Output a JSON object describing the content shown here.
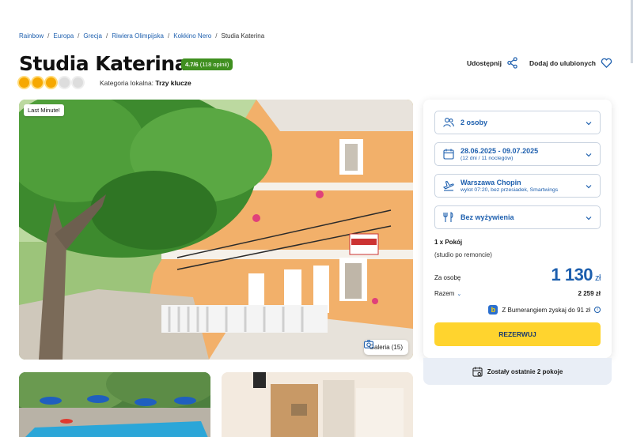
{
  "breadcrumb": [
    "Rainbow",
    "Europa",
    "Grecja",
    "Riwiera Olimpijska",
    "Kokkino Nero",
    "Studia Katerina"
  ],
  "hotel": {
    "name": "Studia Katerina",
    "rating_score": "4.7/6",
    "rating_count": "(118 opinii)",
    "stars_total": 5,
    "stars_filled": 3,
    "category_label": "Kategoria lokalna:",
    "category_value": "Trzy klucze"
  },
  "actions": {
    "share_label": "Udostępnij",
    "favorite_label": "Dodaj do ulubionych"
  },
  "gallery": {
    "badge": "Last Minute!",
    "button_label": "Galeria (15)"
  },
  "booking": {
    "guests": "2 osoby",
    "dates": "28.06.2025 - 09.07.2025",
    "dates_sub": "(12 dni / 11 noclegów)",
    "departure": "Warszawa Chopin",
    "departure_sub": "wylot 07:20, bez przesiadek, Smartwings",
    "board": "Bez wyżywienia",
    "room": "1 x Pokój",
    "room_note": "(studio po remoncie)",
    "per_person_label": "Za osobę",
    "price": "1 130",
    "currency": "zł",
    "total_label": "Razem",
    "total": "2 259 zł",
    "bonus_text": "Z Bumerangiem zyskaj do 91 zł",
    "reserve_label": "REZERWUJ",
    "last_rooms": "Zostały ostatnie 2 pokoje"
  },
  "colors": {
    "accent": "#1d5fae",
    "rating_green": "#3f8f1f",
    "reserve_yellow": "#ffd42e",
    "star_orange": "#f6a800"
  }
}
